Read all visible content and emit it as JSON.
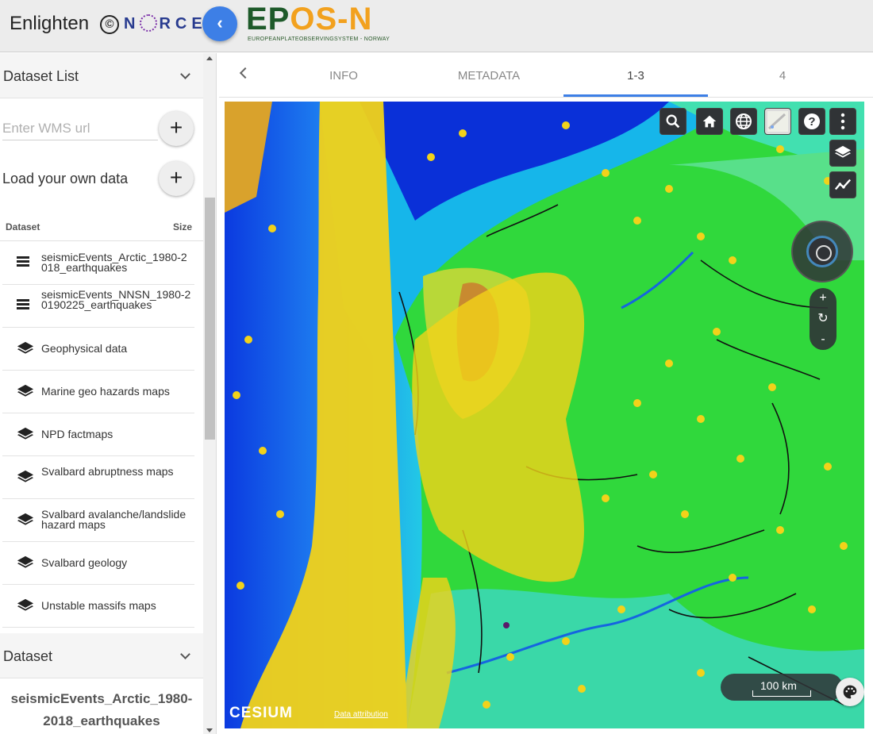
{
  "header": {
    "app_title": "Enlighten",
    "copyright": "©",
    "brand_norce": "N   RCE",
    "epos_part1": "EP",
    "epos_part2": "S-N",
    "epos_subtitle": "EUROPEANPLATEOBSERVINGSYSTEM  -  NORWAY",
    "collapse_icon": "chevron-left-icon"
  },
  "sidebar": {
    "dataset_list_title": "Dataset List",
    "wms_placeholder": "Enter WMS url",
    "load_own_label": "Load your own data",
    "add_symbol": "+",
    "table_col_dataset": "Dataset",
    "table_col_size": "Size",
    "datasets": [
      {
        "name": "seismicEvents_Arctic_1980-2018_earthquakes",
        "icon": "list-icon"
      },
      {
        "name": "seismicEvents_NNSN_1980-20190225_earthquakes",
        "icon": "list-icon"
      },
      {
        "name": "Geophysical data",
        "icon": "layers-icon"
      },
      {
        "name": "Marine geo hazards maps",
        "icon": "layers-icon"
      },
      {
        "name": "NPD factmaps",
        "icon": "layers-icon"
      },
      {
        "name": "Svalbard abruptness maps",
        "icon": "layers-icon"
      },
      {
        "name": "Svalbard avalanche/landslide hazard maps",
        "icon": "layers-icon"
      },
      {
        "name": "Svalbard geology",
        "icon": "layers-icon"
      },
      {
        "name": "Unstable massifs maps",
        "icon": "layers-icon"
      }
    ],
    "dataset_section_title": "Dataset",
    "selected_dataset_line1": "seismicEvents_Arctic_1980-",
    "selected_dataset_line2": "2018_earthquakes"
  },
  "tabs": {
    "items": [
      "INFO",
      "METADATA",
      "1-3",
      "4"
    ],
    "active": "1-3"
  },
  "map": {
    "toolbar_icons": [
      "search-icon",
      "home-icon",
      "globe-icon",
      "basemap-icon",
      "help-icon",
      "more-vert-icon"
    ],
    "scale_label": "100 km",
    "zoom_in": "+",
    "zoom_reset": "↻",
    "zoom_out": "-",
    "attribution_label": "Data attribution",
    "cesium_label": "CESIUM",
    "colors": {
      "deep_sea": "#0a2fd6",
      "shelf": "#19c2e8",
      "land_green": "#2fd83a",
      "highland": "#c8a23a",
      "quake_points": "#f2d21a"
    }
  }
}
